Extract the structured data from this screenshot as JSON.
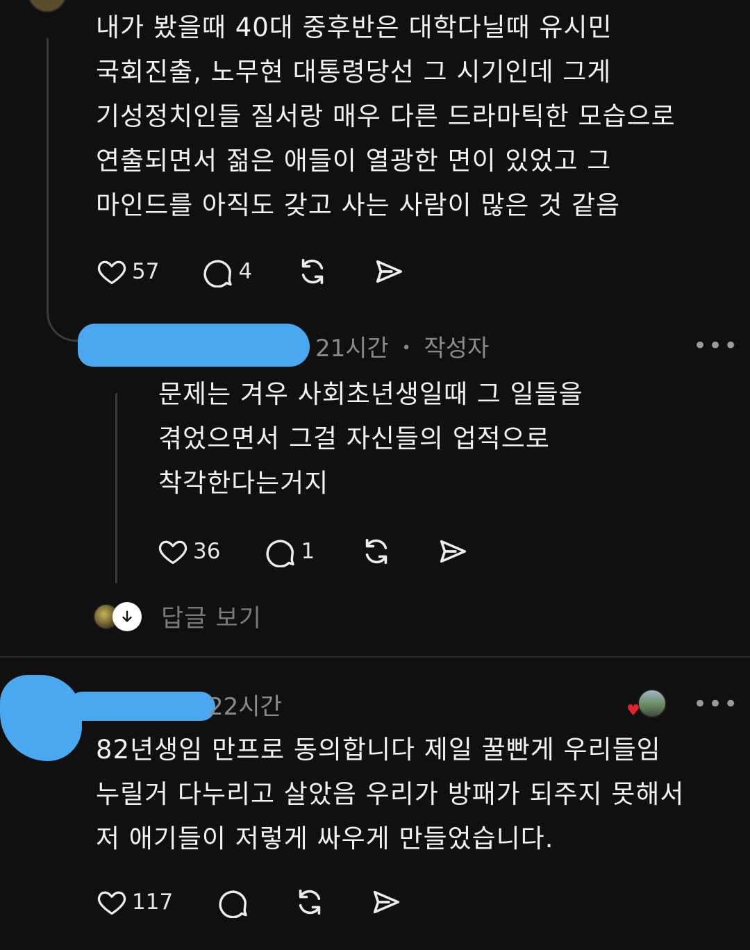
{
  "post1": {
    "lines": [
      "내가 봤을때 40대 중후반은 대학다닐때 유시민",
      "국회진출, 노무현 대통령당선 그 시기인데 그게",
      "기성정치인들 질서랑 매우 다른 드라마틱한 모습으로",
      "연출되면서 젊은 애들이 열광한 면이 있었고 그",
      "마인드를 아직도 갖고 사는 사람이 많은 것 같음"
    ],
    "like_count": "57",
    "reply_count": "4"
  },
  "reply1": {
    "time": "21시간",
    "separator": "•",
    "author_tag": "작성자",
    "more": "•••",
    "lines": [
      "문제는 겨우 사회초년생일때 그 일들을",
      "겪었으면서 그걸 자신들의 업적으로",
      "착각한다는거지"
    ],
    "like_count": "36",
    "reply_count": "1"
  },
  "view_replies": {
    "label": "답글 보기"
  },
  "post2": {
    "time": "22시간",
    "more": "•••",
    "lines": [
      "82년생임 만프로 동의합니다 제일 꿀빤게 우리들임",
      "누릴거 다누리고 살았음 우리가 방패가 되주지 못해서",
      "저 애기들이 저렇게 싸우게 만들었습니다."
    ],
    "like_count": "117",
    "heart_badge": "♥"
  },
  "colors": {
    "background": "#101010",
    "text": "#f2f2f2",
    "meta": "#8a8a8a",
    "redaction": "#49a8ef",
    "like_badge": "#e0242f"
  },
  "icons": [
    "heart-icon",
    "comment-icon",
    "repost-icon",
    "share-icon",
    "arrow-down-icon",
    "more-icon"
  ]
}
